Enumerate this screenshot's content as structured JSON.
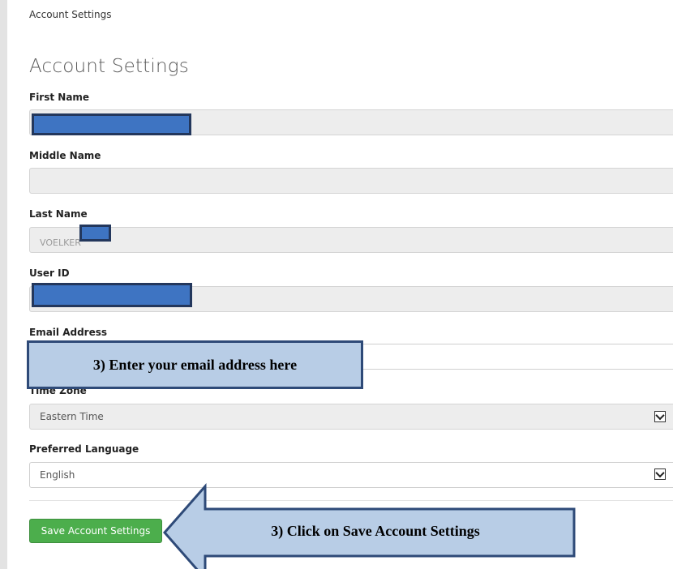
{
  "breadcrumb": "Account Settings",
  "page_title": "Account Settings",
  "fields": {
    "first_name": {
      "label": "First Name",
      "value": ""
    },
    "middle_name": {
      "label": "Middle Name",
      "value": ""
    },
    "last_name": {
      "label": "Last Name",
      "value": "VOELKER"
    },
    "user_id": {
      "label": "User ID",
      "value": ""
    },
    "email": {
      "label": "Email Address",
      "value": ""
    },
    "time_zone": {
      "label": "Time Zone",
      "value": "Eastern Time"
    },
    "language": {
      "label": "Preferred Language",
      "value": "English"
    }
  },
  "save_button": "Save Account Settings",
  "annotations": {
    "email_callout": "3) Enter your email address here",
    "save_callout": "3) Click on Save Account Settings"
  },
  "colors": {
    "save_button": "#4cae4c",
    "callout_fill": "#b8cde6",
    "callout_border": "#2e4a78",
    "redaction": "#3e74c2"
  }
}
